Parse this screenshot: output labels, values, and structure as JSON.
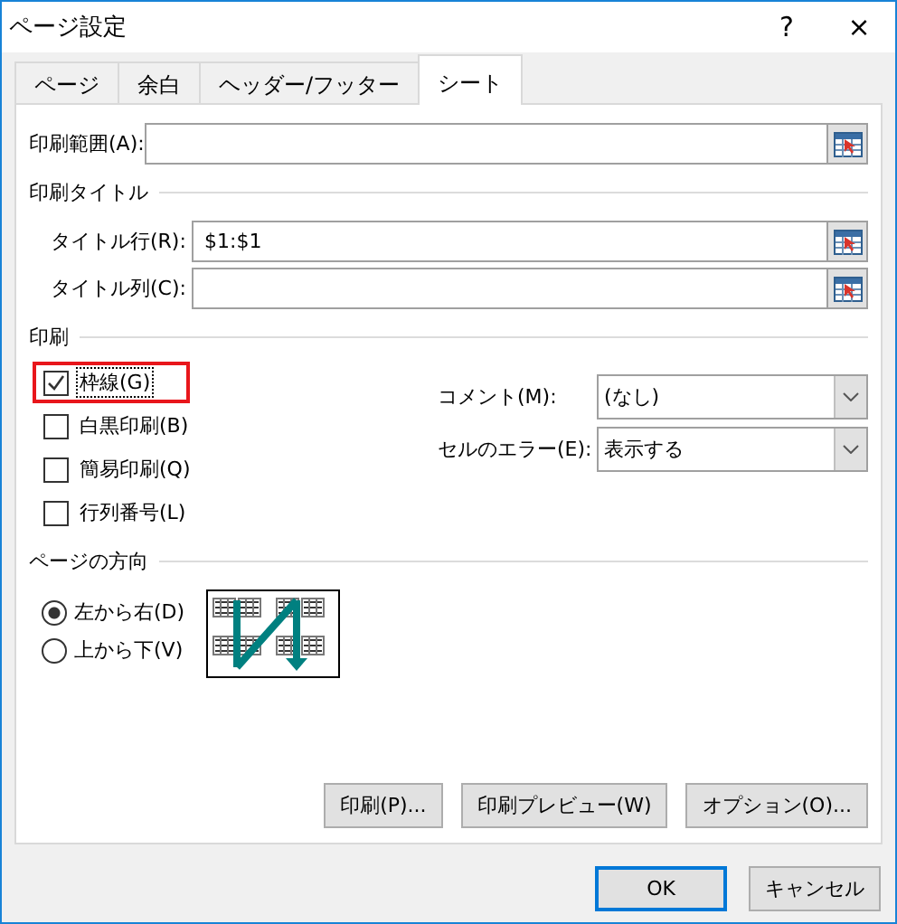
{
  "window": {
    "title": "ページ設定",
    "help": "?",
    "close": "×"
  },
  "tabs": [
    {
      "label": "ページ",
      "selected": false
    },
    {
      "label": "余白",
      "selected": false
    },
    {
      "label": "ヘッダー/フッター",
      "selected": false
    },
    {
      "label": "シート",
      "selected": true
    }
  ],
  "print_area": {
    "label": "印刷範囲(A):"
  },
  "print_titles": {
    "heading": "印刷タイトル",
    "fields": [
      {
        "label": "タイトル行(R):",
        "value": "$1:$1"
      },
      {
        "label": "タイトル列(C):"
      }
    ]
  },
  "print": {
    "heading": "印刷",
    "options": [
      {
        "label": "枠線(G)",
        "checked": true,
        "focused": true,
        "highlighted": true
      },
      {
        "label": "白黒印刷(B)",
        "checked": false,
        "focused": false,
        "highlighted": false
      },
      {
        "label": "簡易印刷(Q)",
        "checked": false,
        "focused": false,
        "highlighted": false
      },
      {
        "label": "行列番号(L)",
        "checked": false,
        "focused": false,
        "highlighted": false
      }
    ],
    "dropdowns": [
      {
        "label": "コメント(M):",
        "value": "(なし)"
      },
      {
        "label": "セルのエラー(E):",
        "value": "表示する"
      }
    ]
  },
  "page_order": {
    "heading": "ページの方向",
    "options": [
      {
        "label": "左から右(D)",
        "selected": true
      },
      {
        "label": "上から下(V)",
        "selected": false
      }
    ]
  },
  "panel_buttons": [
    "印刷(P)...",
    "印刷プレビュー(W)",
    "オプション(O)..."
  ],
  "dialog_buttons": [
    {
      "label": "OK",
      "default": true
    },
    {
      "label": "キャンセル",
      "default": false
    }
  ]
}
